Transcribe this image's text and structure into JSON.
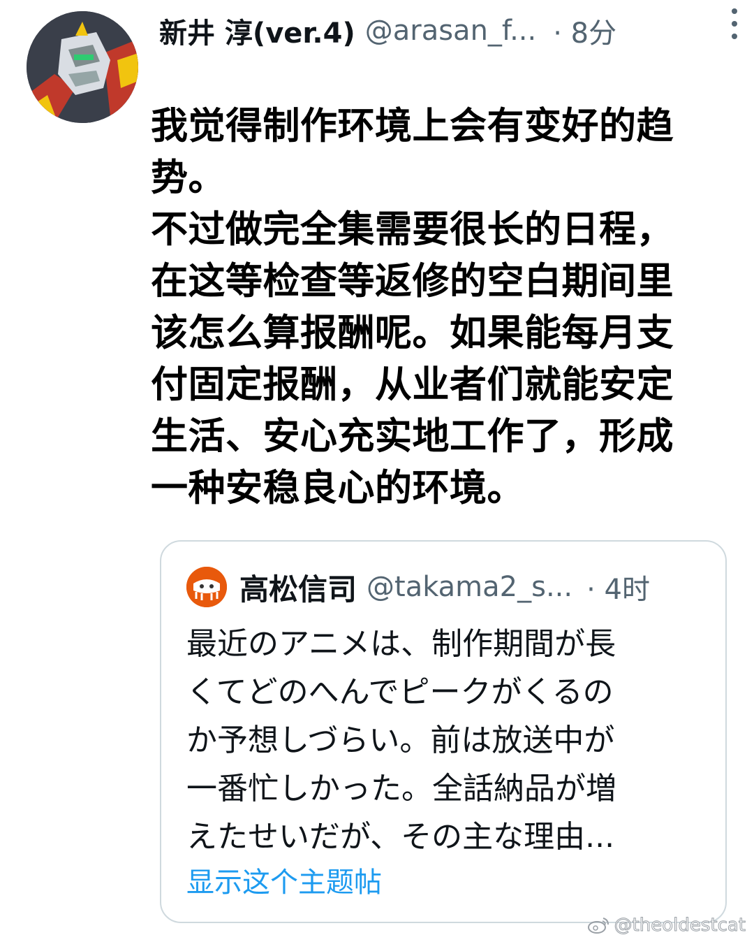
{
  "tweet": {
    "author_name": "新井 淳(ver.4)",
    "author_handle": "@arasan_f...",
    "time": "· 8分",
    "more_icon": "more-vertical-icon",
    "text_lines": [
      "我觉得制作环境上会有变好的趋",
      "势。",
      "不过做完全集需要很长的日程，",
      "在这等检查等返修的空白期间里",
      "该怎么算报酬呢。如果能每月支",
      "付固定报酬，从业者们就能安定",
      "生活、安心充实地工作了，形成",
      "一种安稳良心的环境。"
    ]
  },
  "quote": {
    "author_name": "高松信司",
    "author_handle": "@takama2_s...",
    "time": "· 4时",
    "text_lines": [
      "最近のアニメは、制作期間が長",
      "くてどのへんでピークがくるの",
      "か予想しづらい。前は放送中が",
      "一番忙しかった。全話納品が増",
      "えたせいだが、その主な理由..."
    ],
    "show_thread_label": "显示这个主题帖"
  },
  "watermark": {
    "text": "@theoldestcat",
    "icon": "weibo-icon"
  },
  "colors": {
    "text_primary": "#0f1419",
    "text_secondary": "#536471",
    "link": "#1d9bf0",
    "border": "#cfd9de",
    "quote_avatar_bg": "#e8590c"
  }
}
